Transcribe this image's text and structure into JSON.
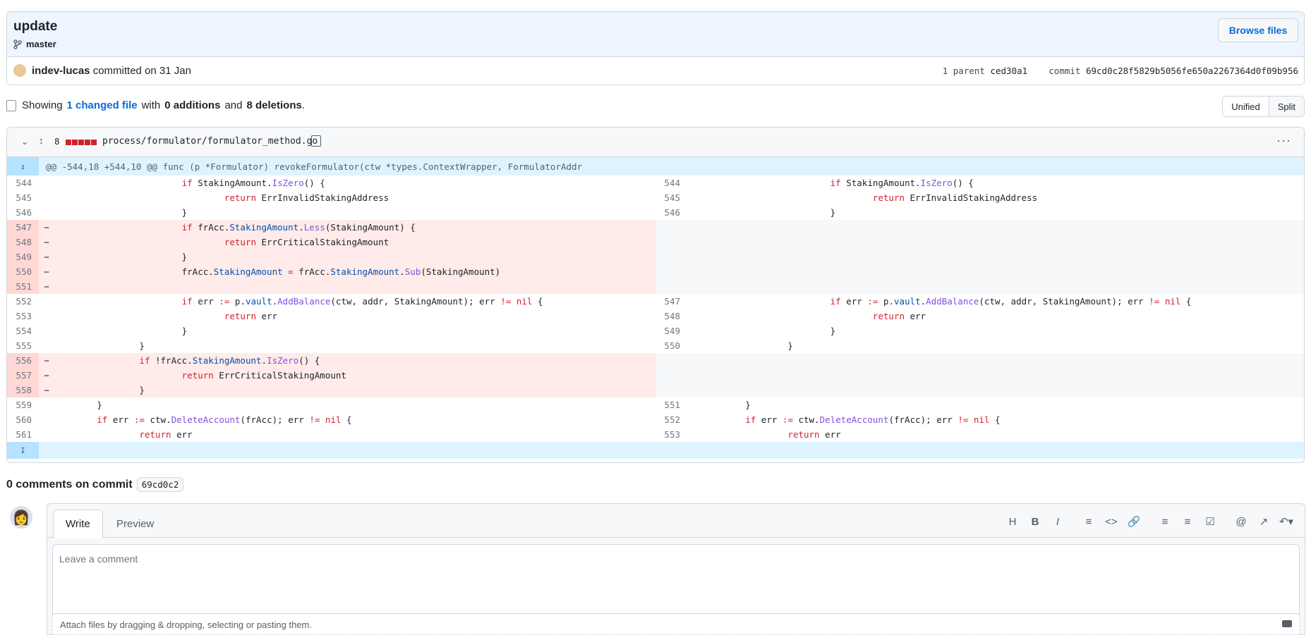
{
  "commit": {
    "title": "update",
    "branch": "master",
    "browse_label": "Browse files",
    "author": "indev-lucas",
    "committed_text": "committed on 31 Jan",
    "parent_label": "1 parent",
    "parent_sha": "ced30a1",
    "commit_label": "commit",
    "commit_sha": "69cd0c28f5829b5056fe650a2267364d0f09b956"
  },
  "summary": {
    "showing": "Showing",
    "changed": "1 changed file",
    "with": "with",
    "additions": "0 additions",
    "and": "and",
    "deletions": "8 deletions",
    "period": "."
  },
  "view_toggle": {
    "unified": "Unified",
    "split": "Split"
  },
  "file": {
    "count": "8",
    "path": "process/formulator/formulator_method.go",
    "hunk": "@@ -544,18 +544,10 @@ func (p *Formulator) revokeFormulator(ctw *types.ContextWrapper, FormulatorAddr"
  },
  "diff_rows": [
    {
      "l": "544",
      "lc": "\t\t\tif StakingAmount.IsZero() {",
      "r": "544",
      "rc": "\t\t\tif StakingAmount.IsZero() {",
      "t": "ctx"
    },
    {
      "l": "545",
      "lc": "\t\t\t\treturn ErrInvalidStakingAddress",
      "r": "545",
      "rc": "\t\t\t\treturn ErrInvalidStakingAddress",
      "t": "ctx"
    },
    {
      "l": "546",
      "lc": "\t\t\t}",
      "r": "546",
      "rc": "\t\t\t}",
      "t": "ctx"
    },
    {
      "l": "547",
      "lc": "\t\t\tif frAcc.StakingAmount.Less(StakingAmount) {",
      "r": "",
      "rc": "",
      "t": "del"
    },
    {
      "l": "548",
      "lc": "\t\t\t\treturn ErrCriticalStakingAmount",
      "r": "",
      "rc": "",
      "t": "del"
    },
    {
      "l": "549",
      "lc": "\t\t\t}",
      "r": "",
      "rc": "",
      "t": "del"
    },
    {
      "l": "550",
      "lc": "\t\t\tfrAcc.StakingAmount = frAcc.StakingAmount.Sub(StakingAmount)",
      "r": "",
      "rc": "",
      "t": "del"
    },
    {
      "l": "551",
      "lc": "",
      "r": "",
      "rc": "",
      "t": "del"
    },
    {
      "l": "552",
      "lc": "\t\t\tif err := p.vault.AddBalance(ctw, addr, StakingAmount); err != nil {",
      "r": "547",
      "rc": "\t\t\tif err := p.vault.AddBalance(ctw, addr, StakingAmount); err != nil {",
      "t": "ctx"
    },
    {
      "l": "553",
      "lc": "\t\t\t\treturn err",
      "r": "548",
      "rc": "\t\t\t\treturn err",
      "t": "ctx"
    },
    {
      "l": "554",
      "lc": "\t\t\t}",
      "r": "549",
      "rc": "\t\t\t}",
      "t": "ctx"
    },
    {
      "l": "555",
      "lc": "\t\t}",
      "r": "550",
      "rc": "\t\t}",
      "t": "ctx"
    },
    {
      "l": "556",
      "lc": "\t\tif !frAcc.StakingAmount.IsZero() {",
      "r": "",
      "rc": "",
      "t": "del"
    },
    {
      "l": "557",
      "lc": "\t\t\treturn ErrCriticalStakingAmount",
      "r": "",
      "rc": "",
      "t": "del"
    },
    {
      "l": "558",
      "lc": "\t\t}",
      "r": "",
      "rc": "",
      "t": "del"
    },
    {
      "l": "559",
      "lc": "\t}",
      "r": "551",
      "rc": "\t}",
      "t": "ctx"
    },
    {
      "l": "560",
      "lc": "\tif err := ctw.DeleteAccount(frAcc); err != nil {",
      "r": "552",
      "rc": "\tif err := ctw.DeleteAccount(frAcc); err != nil {",
      "t": "ctx"
    },
    {
      "l": "561",
      "lc": "\t\treturn err",
      "r": "553",
      "rc": "\t\treturn err",
      "t": "ctx"
    }
  ],
  "comments": {
    "title": "0 comments on commit",
    "sha": "69cd0c2",
    "write_tab": "Write",
    "preview_tab": "Preview",
    "placeholder": "Leave a comment",
    "attach": "Attach files by dragging & dropping, selecting or pasting them."
  },
  "toolbar_icons": [
    "heading-icon",
    "bold-icon",
    "italic-icon",
    "quote-icon",
    "code-icon",
    "link-icon",
    "bullet-list-icon",
    "numbered-list-icon",
    "task-list-icon",
    "mention-icon",
    "reference-icon",
    "reply-icon"
  ]
}
